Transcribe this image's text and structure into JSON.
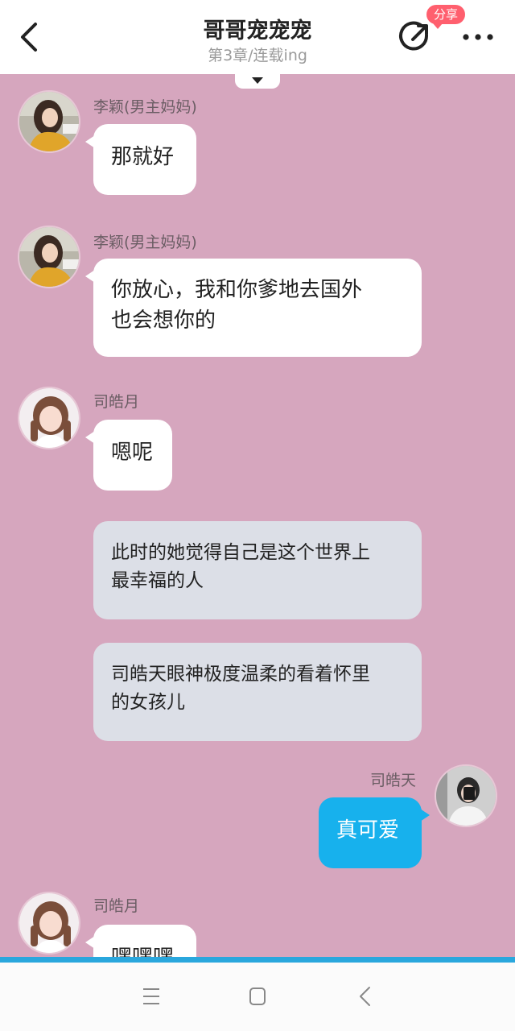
{
  "header": {
    "title": "哥哥宠宠宠",
    "subtitle": "第3章/连载ing",
    "share_badge": "分享"
  },
  "messages": [
    {
      "type": "left",
      "name": "李颖(男主妈妈)",
      "text": "那就好",
      "avatar": "woman-yellow-jacket"
    },
    {
      "type": "left",
      "name": "李颖(男主妈妈)",
      "text": "你放心，我和你爹地去国外\n也会想你的",
      "avatar": "woman-yellow-jacket"
    },
    {
      "type": "left",
      "name": "司皓月",
      "text": "嗯呢",
      "avatar": "girl-braids"
    },
    {
      "type": "narration",
      "text": "此时的她觉得自己是这个世界上\n最幸福的人"
    },
    {
      "type": "narration",
      "text": "司皓天眼神极度温柔的看着怀里\n的女孩儿"
    },
    {
      "type": "right",
      "name": "司皓天",
      "text": "真可爱",
      "avatar": "boy-white-hoodie"
    },
    {
      "type": "left",
      "name": "司皓月",
      "text": "嘿嘿嘿",
      "avatar": "girl-braids"
    }
  ],
  "colors": {
    "chat_background": "#d6a6be",
    "right_bubble": "#17b1ed",
    "narration_bubble": "#dcdfe7",
    "badge": "#ff5f6e"
  },
  "icons": {
    "back": "chevron-left-icon",
    "share": "share-arrow-icon",
    "more": "more-dots-icon",
    "expand": "triangle-down-icon",
    "nav_menu": "menu-lines-icon",
    "nav_home": "square-home-icon",
    "nav_back": "chevron-left-icon"
  }
}
